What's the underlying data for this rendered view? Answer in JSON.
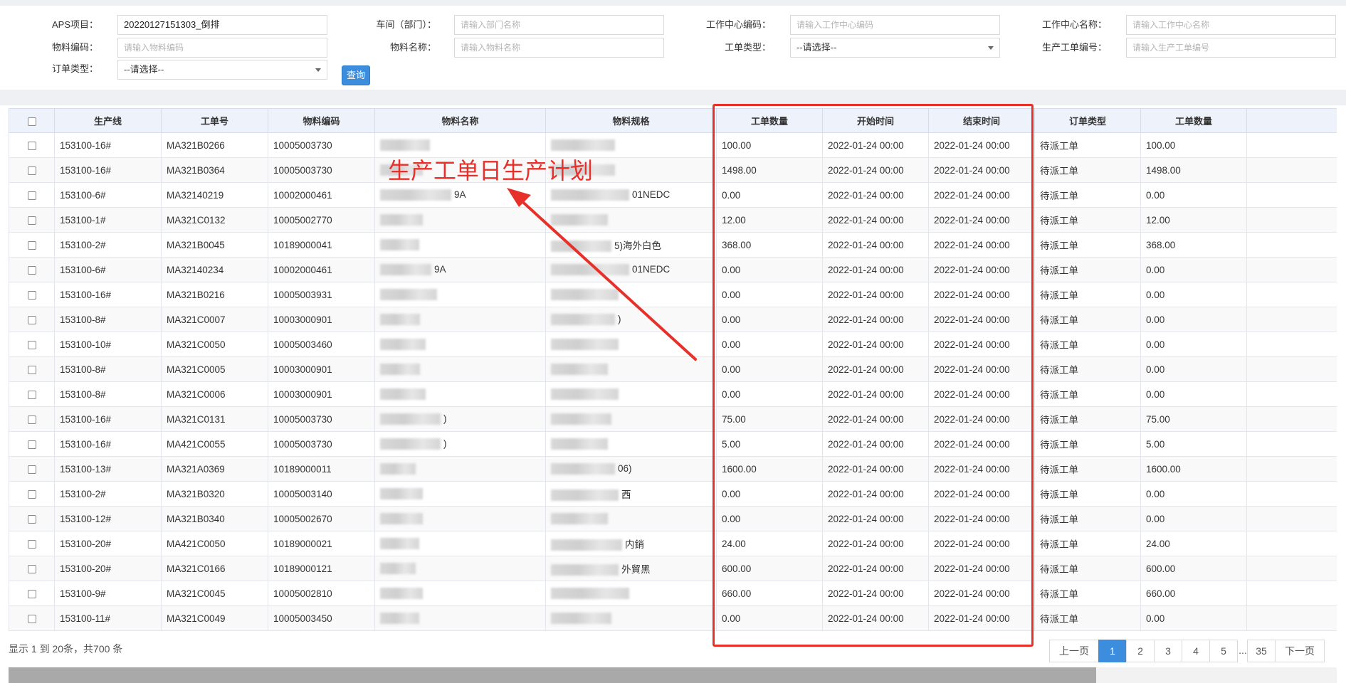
{
  "filters": {
    "aps_project_label": "APS项目：",
    "aps_project_value": "20220127151303_倒排",
    "workshop_label": "车间（部门）：",
    "workshop_placeholder": "请输入部门名称",
    "wc_code_label": "工作中心编码：",
    "wc_code_placeholder": "请输入工作中心编码",
    "wc_name_label": "工作中心名称：",
    "wc_name_placeholder": "请输入工作中心名称",
    "material_code_label": "物料编码：",
    "material_code_placeholder": "请输入物料编码",
    "material_name_label": "物料名称：",
    "material_name_placeholder": "请输入物料名称",
    "order_kind_label": "工单类型：",
    "order_kind_value": "--请选择--",
    "prod_order_no_label": "生产工单编号：",
    "prod_order_no_placeholder": "请输入生产工单编号",
    "order_type_label": "订单类型：",
    "order_type_value": "--请选择--",
    "query_button": "查询"
  },
  "table": {
    "headers": [
      "生产线",
      "工单号",
      "物料编码",
      "物料名称",
      "物料规格",
      "工单数量",
      "开始时间",
      "结束时间",
      "订单类型",
      "工单数量"
    ],
    "rows": [
      {
        "line": "153100-16#",
        "order": "MA321B0266",
        "code": "10005003730",
        "name_sfx": "",
        "spec_sfx": "",
        "qty": "100.00",
        "start": "2022-01-24 00:00",
        "end": "2022-01-24 00:00",
        "type": "待派工单",
        "qty2": "100.00"
      },
      {
        "line": "153100-16#",
        "order": "MA321B0364",
        "code": "10005003730",
        "name_sfx": "",
        "spec_sfx": "",
        "qty": "1498.00",
        "start": "2022-01-24 00:00",
        "end": "2022-01-24 00:00",
        "type": "待派工单",
        "qty2": "1498.00"
      },
      {
        "line": "153100-6#",
        "order": "MA32140219",
        "code": "10002000461",
        "name_sfx": "9A",
        "spec_sfx": "01NEDC",
        "qty": "0.00",
        "start": "2022-01-24 00:00",
        "end": "2022-01-24 00:00",
        "type": "待派工单",
        "qty2": "0.00"
      },
      {
        "line": "153100-1#",
        "order": "MA321C0132",
        "code": "10005002770",
        "name_sfx": "",
        "spec_sfx": "",
        "qty": "12.00",
        "start": "2022-01-24 00:00",
        "end": "2022-01-24 00:00",
        "type": "待派工单",
        "qty2": "12.00"
      },
      {
        "line": "153100-2#",
        "order": "MA321B0045",
        "code": "10189000041",
        "name_sfx": "",
        "spec_sfx": "5)海外白色",
        "qty": "368.00",
        "start": "2022-01-24 00:00",
        "end": "2022-01-24 00:00",
        "type": "待派工单",
        "qty2": "368.00"
      },
      {
        "line": "153100-6#",
        "order": "MA32140234",
        "code": "10002000461",
        "name_sfx": "9A",
        "spec_sfx": "01NEDC",
        "qty": "0.00",
        "start": "2022-01-24 00:00",
        "end": "2022-01-24 00:00",
        "type": "待派工单",
        "qty2": "0.00"
      },
      {
        "line": "153100-16#",
        "order": "MA321B0216",
        "code": "10005003931",
        "name_sfx": "",
        "spec_sfx": "",
        "qty": "0.00",
        "start": "2022-01-24 00:00",
        "end": "2022-01-24 00:00",
        "type": "待派工单",
        "qty2": "0.00"
      },
      {
        "line": "153100-8#",
        "order": "MA321C0007",
        "code": "10003000901",
        "name_sfx": "",
        "spec_sfx": ")",
        "qty": "0.00",
        "start": "2022-01-24 00:00",
        "end": "2022-01-24 00:00",
        "type": "待派工单",
        "qty2": "0.00"
      },
      {
        "line": "153100-10#",
        "order": "MA321C0050",
        "code": "10005003460",
        "name_sfx": "",
        "spec_sfx": "",
        "qty": "0.00",
        "start": "2022-01-24 00:00",
        "end": "2022-01-24 00:00",
        "type": "待派工单",
        "qty2": "0.00"
      },
      {
        "line": "153100-8#",
        "order": "MA321C0005",
        "code": "10003000901",
        "name_sfx": "",
        "spec_sfx": "",
        "qty": "0.00",
        "start": "2022-01-24 00:00",
        "end": "2022-01-24 00:00",
        "type": "待派工单",
        "qty2": "0.00"
      },
      {
        "line": "153100-8#",
        "order": "MA321C0006",
        "code": "10003000901",
        "name_sfx": "",
        "spec_sfx": "",
        "qty": "0.00",
        "start": "2022-01-24 00:00",
        "end": "2022-01-24 00:00",
        "type": "待派工单",
        "qty2": "0.00"
      },
      {
        "line": "153100-16#",
        "order": "MA321C0131",
        "code": "10005003730",
        "name_sfx": ")",
        "spec_sfx": "",
        "qty": "75.00",
        "start": "2022-01-24 00:00",
        "end": "2022-01-24 00:00",
        "type": "待派工单",
        "qty2": "75.00"
      },
      {
        "line": "153100-16#",
        "order": "MA421C0055",
        "code": "10005003730",
        "name_sfx": ")",
        "spec_sfx": "",
        "qty": "5.00",
        "start": "2022-01-24 00:00",
        "end": "2022-01-24 00:00",
        "type": "待派工单",
        "qty2": "5.00"
      },
      {
        "line": "153100-13#",
        "order": "MA321A0369",
        "code": "10189000011",
        "name_sfx": "",
        "spec_sfx": "06)",
        "qty": "1600.00",
        "start": "2022-01-24 00:00",
        "end": "2022-01-24 00:00",
        "type": "待派工单",
        "qty2": "1600.00"
      },
      {
        "line": "153100-2#",
        "order": "MA321B0320",
        "code": "10005003140",
        "name_sfx": "",
        "spec_sfx": "西",
        "qty": "0.00",
        "start": "2022-01-24 00:00",
        "end": "2022-01-24 00:00",
        "type": "待派工单",
        "qty2": "0.00"
      },
      {
        "line": "153100-12#",
        "order": "MA321B0340",
        "code": "10005002670",
        "name_sfx": "",
        "spec_sfx": "",
        "qty": "0.00",
        "start": "2022-01-24 00:00",
        "end": "2022-01-24 00:00",
        "type": "待派工单",
        "qty2": "0.00"
      },
      {
        "line": "153100-20#",
        "order": "MA421C0050",
        "code": "10189000021",
        "name_sfx": "",
        "spec_sfx": "内銷",
        "qty": "24.00",
        "start": "2022-01-24 00:00",
        "end": "2022-01-24 00:00",
        "type": "待派工单",
        "qty2": "24.00"
      },
      {
        "line": "153100-20#",
        "order": "MA321C0166",
        "code": "10189000121",
        "name_sfx": "",
        "spec_sfx": "外貿黑",
        "qty": "600.00",
        "start": "2022-01-24 00:00",
        "end": "2022-01-24 00:00",
        "type": "待派工单",
        "qty2": "600.00"
      },
      {
        "line": "153100-9#",
        "order": "MA321C0045",
        "code": "10005002810",
        "name_sfx": "",
        "spec_sfx": "",
        "qty": "660.00",
        "start": "2022-01-24 00:00",
        "end": "2022-01-24 00:00",
        "type": "待派工单",
        "qty2": "660.00"
      },
      {
        "line": "153100-11#",
        "order": "MA321C0049",
        "code": "10005003450",
        "name_sfx": "",
        "spec_sfx": "",
        "qty": "0.00",
        "start": "2022-01-24 00:00",
        "end": "2022-01-24 00:00",
        "type": "待派工单",
        "qty2": "0.00"
      }
    ]
  },
  "annotation": {
    "text": "生产工单日生产计划",
    "color": "#e8302a"
  },
  "footer": {
    "page_info": "显示 1 到 20条，共700 条",
    "prev": "上一页",
    "next": "下一页",
    "pages": [
      "1",
      "2",
      "3",
      "4",
      "5",
      "...",
      "35"
    ],
    "current_page": "1"
  },
  "colors": {
    "accent": "#3c8dde",
    "highlight": "#e8302a",
    "header_bg": "#eef3fb"
  }
}
